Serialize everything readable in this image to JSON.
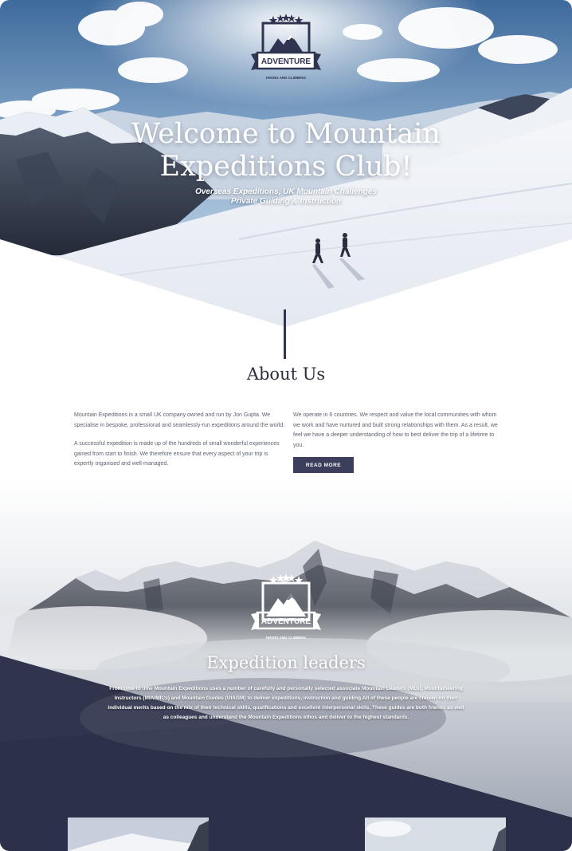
{
  "logo": {
    "badge_text": "ADVENTURE",
    "badge_subtext": "HIKING AND CLIMBING"
  },
  "hero": {
    "title_line1": "Welcome to Mountain",
    "title_line2": "Expeditions Club!",
    "tagline_line1": "Overseas Expeditions, UK Mountain Challenges",
    "tagline_line2": "Private Guiding & Instruction"
  },
  "about": {
    "heading": "About Us",
    "left_p1": "Mountain Expeditions is a small UK company owned and run by Jon Gupta. We specialise in bespoke, professional and seamlessly-run expeditions around the world.",
    "left_p2": "A successful expedition is made up of the hundreds of small wonderful experiences gained from start to finish. We therefore ensure that every aspect of your trip is expertly organised and well-managed.",
    "right_p1": "We operate in 6 countries. We respect and value the local communities with whom we work and have nurtured and built strong relationships with them. As a result, we feel we have a deeper understanding of how to best deliver the trip of a lifetime to you.",
    "button_label": "READ MORE"
  },
  "expedition": {
    "heading": "Expedition leaders",
    "body": "From time to time Mountain Expeditions uses a number of carefully and personally selected associate Mountain Leaders (MLs), Mountaineering Instructors (MIA/MICs) and Mountain Guides (UIAGM) to deliver expeditions, instruction and guiding.All of these people are chosen on their individual merits based on the mix of their technical skills, qualifications and excellent interpersonal skills. These guides are both friends as well as colleagues and understand the Mountain Expeditions ethos and deliver to the highest standards."
  },
  "colors": {
    "navy": "#2f3550",
    "button": "#3b3f5c",
    "text_gray": "#5d6270",
    "heading_dark": "#2b2e3d"
  }
}
